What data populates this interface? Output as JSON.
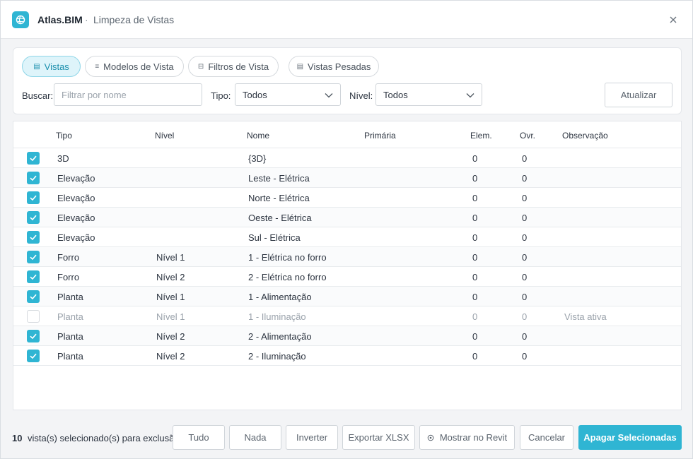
{
  "titlebar": {
    "app_name": "Atlas.BIM",
    "separator": "·",
    "window_title": "Limpeza de Vistas"
  },
  "tabs": [
    {
      "label": "Vistas",
      "icon": "document-icon",
      "active": true
    },
    {
      "label": "Modelos de Vista",
      "icon": "list-icon",
      "active": false
    },
    {
      "label": "Filtros de Vista",
      "icon": "filter-icon",
      "active": false
    },
    {
      "label": "Vistas Pesadas",
      "icon": "document-icon",
      "active": false
    }
  ],
  "filters": {
    "search_label": "Buscar:",
    "search_placeholder": "Filtrar por nome",
    "search_value": "",
    "type_label": "Tipo:",
    "type_value": "Todos",
    "level_label": "Nível:",
    "level_value": "Todos",
    "refresh_label": "Atualizar"
  },
  "table": {
    "columns": [
      "Tipo",
      "Nível",
      "Nome",
      "Primária",
      "Elem.",
      "Ovr.",
      "Observação"
    ],
    "rows": [
      {
        "checked": true,
        "disabled": false,
        "tipo": "3D",
        "nivel": "",
        "nome": "{3D}",
        "primaria": "",
        "elem": "0",
        "ovr": "0",
        "obs": ""
      },
      {
        "checked": true,
        "disabled": false,
        "tipo": "Elevação",
        "nivel": "",
        "nome": "Leste - Elétrica",
        "primaria": "",
        "elem": "0",
        "ovr": "0",
        "obs": ""
      },
      {
        "checked": true,
        "disabled": false,
        "tipo": "Elevação",
        "nivel": "",
        "nome": "Norte - Elétrica",
        "primaria": "",
        "elem": "0",
        "ovr": "0",
        "obs": ""
      },
      {
        "checked": true,
        "disabled": false,
        "tipo": "Elevação",
        "nivel": "",
        "nome": "Oeste - Elétrica",
        "primaria": "",
        "elem": "0",
        "ovr": "0",
        "obs": ""
      },
      {
        "checked": true,
        "disabled": false,
        "tipo": "Elevação",
        "nivel": "",
        "nome": "Sul - Elétrica",
        "primaria": "",
        "elem": "0",
        "ovr": "0",
        "obs": ""
      },
      {
        "checked": true,
        "disabled": false,
        "tipo": "Forro",
        "nivel": "Nível 1",
        "nome": "1 - Elétrica no forro",
        "primaria": "",
        "elem": "0",
        "ovr": "0",
        "obs": ""
      },
      {
        "checked": true,
        "disabled": false,
        "tipo": "Forro",
        "nivel": "Nível 2",
        "nome": "2 - Elétrica no forro",
        "primaria": "",
        "elem": "0",
        "ovr": "0",
        "obs": ""
      },
      {
        "checked": true,
        "disabled": false,
        "tipo": "Planta",
        "nivel": "Nível 1",
        "nome": "1 - Alimentação",
        "primaria": "",
        "elem": "0",
        "ovr": "0",
        "obs": ""
      },
      {
        "checked": false,
        "disabled": true,
        "tipo": "Planta",
        "nivel": "Nível 1",
        "nome": "1 - Iluminação",
        "primaria": "",
        "elem": "0",
        "ovr": "0",
        "obs": "Vista ativa"
      },
      {
        "checked": true,
        "disabled": false,
        "tipo": "Planta",
        "nivel": "Nível 2",
        "nome": "2 - Alimentação",
        "primaria": "",
        "elem": "0",
        "ovr": "0",
        "obs": ""
      },
      {
        "checked": true,
        "disabled": false,
        "tipo": "Planta",
        "nivel": "Nível 2",
        "nome": "2 - Iluminação",
        "primaria": "",
        "elem": "0",
        "ovr": "0",
        "obs": ""
      }
    ]
  },
  "footer": {
    "count": "10",
    "count_text": "vista(s)  selecionado(s) para exclusão",
    "all_label": "Tudo",
    "none_label": "Nada",
    "invert_label": "Inverter",
    "export_label": "Exportar XLSX",
    "show_label": "Mostrar no Revit",
    "cancel_label": "Cancelar",
    "delete_label": "Apagar Selecionadas"
  },
  "colors": {
    "accent": "#2fb5d3",
    "tab_active_bg": "#def4fa",
    "text": "#2c3440",
    "muted": "#9aa2ab"
  }
}
